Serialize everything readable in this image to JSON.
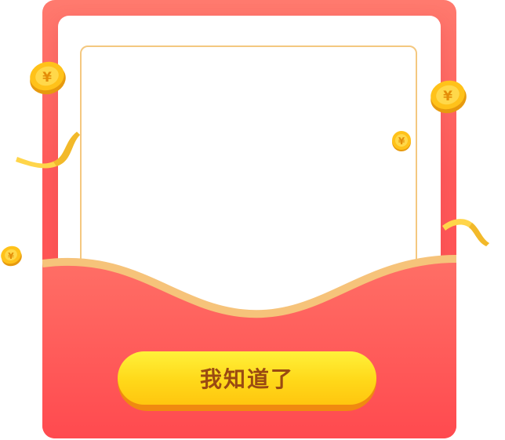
{
  "dialog": {
    "confirm_label": "我知道了",
    "coin_symbol": "¥"
  },
  "colors": {
    "envelope_top": "#ff7a6e",
    "envelope_bottom": "#ff4b4e",
    "frame_border": "#f4c880",
    "button_top": "#fff13a",
    "button_bottom": "#ffc60f",
    "button_text": "#9a4a12",
    "coin_gold": "#ffc21a",
    "ribbon_gold": "#ffd54a"
  },
  "decorations": [
    "coin-icon",
    "coin-icon",
    "coin-icon",
    "coin-icon",
    "ribbon-icon",
    "ribbon-icon"
  ]
}
